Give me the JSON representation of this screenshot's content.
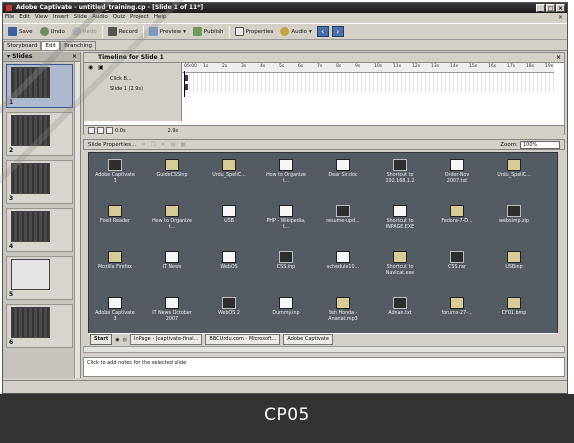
{
  "window": {
    "title": "Adobe Captivate - untitled_training.cp - [Slide 1 of 11*]",
    "controls": [
      "_",
      "□",
      "×"
    ]
  },
  "menu": [
    "File",
    "Edit",
    "View",
    "Insert",
    "Slide",
    "Audio",
    "Quiz",
    "Project",
    "Help"
  ],
  "toolbar": {
    "save": "Save",
    "undo": "Undo",
    "redo": "Redo",
    "record": "Record",
    "preview": "Preview",
    "publish": "Publish",
    "properties": "Properties",
    "audio": "Audio"
  },
  "view_tabs": [
    "Storyboard",
    "Edit",
    "Branching"
  ],
  "slides_panel": {
    "title": "Slides",
    "numbers": [
      "1",
      "2",
      "3",
      "4",
      "5",
      "6"
    ]
  },
  "timeline": {
    "title": "Timeline for Slide 1",
    "ruler": [
      "00:00",
      "1s",
      "2s",
      "3s",
      "4s",
      "5s",
      "6s",
      "7s",
      "8s",
      "9s",
      "10s",
      "11s",
      "12s",
      "13s",
      "14s",
      "15s",
      "16s",
      "17s",
      "18s",
      "19s"
    ],
    "rows": [
      "Click B...",
      "Slide 1 (2.9s)"
    ],
    "time_left": "0.0s",
    "time_right": "2.9s"
  },
  "stage_toolbar": {
    "slide_properties": "Slide Properties...",
    "zoom_label": "Zoom:",
    "zoom_value": "100%"
  },
  "desktop_icons": [
    "Adobe Captivate 3",
    "GuideCSSInp",
    "Urdu_SpellC...",
    "How to Organize t...",
    "Dear Sir.doc",
    "Shortcut to 192.168.1.2",
    "Order-Nov 2007.txt",
    "Urdu_SpellC...",
    "Foxit Reader",
    "How to Organize t...",
    "USB",
    "PHP - Wikipedia, t...",
    "resume-upd...",
    "Shortcut to INPAGE.EXE",
    "Fedora-7-D...",
    "websimp.zip",
    "Mozilla Firefox",
    "IT News",
    "WebOS",
    "CSS.inp",
    "schedule10...",
    "Shortcut to Navicat.exe",
    "CSS.rar",
    "USBinp",
    "Adobe Captivate 3",
    "IT News October 2007",
    "WebOS 2",
    "Dummy.inp",
    "Yeh Honda - Ananat.mp3",
    "Adnan.txt",
    "forums-27-...",
    "CF01.bmp"
  ],
  "taskbar": {
    "start": "Start",
    "items": [
      "InPage - [captivate-final...",
      "BBCUrdu.com - Microsoft...",
      "Adobe Captivate"
    ]
  },
  "notes": "Click to add notes for the selected slide",
  "caption": "CP05",
  "colors": {
    "title_bar": "#2a2a2a",
    "stage": "#555b63",
    "caption_bg": "#333333",
    "chrome": "#d4d0c8"
  }
}
